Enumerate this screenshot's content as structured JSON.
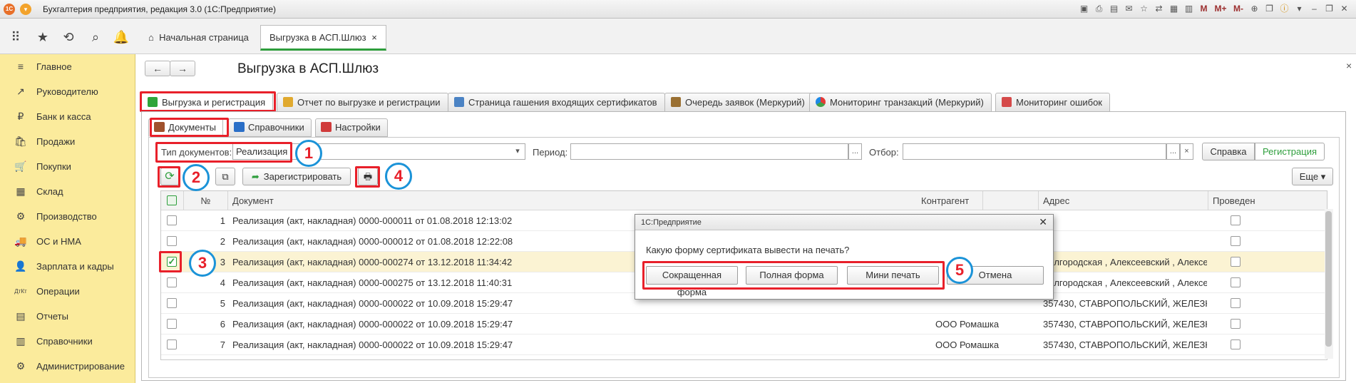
{
  "window": {
    "title": "Бухгалтерия предприятия, редакция 3.0  (1С:Предприятие)",
    "logo": "1С"
  },
  "titlebar_icons": [
    "save-icon",
    "print-icon",
    "preview-icon",
    "mail-icon",
    "star-icon",
    "nav-icon",
    "calendar-icon",
    "calc-icon",
    "M",
    "M+",
    "M-",
    "zoom-icon",
    "window-icon",
    "info-icon",
    "chevron-down-icon",
    "minimize-icon",
    "restore-icon",
    "close-icon"
  ],
  "topnav": {
    "tabs": [
      {
        "label": "Начальная страница"
      },
      {
        "label": "Выгрузка в АСП.Шлюз",
        "close": "×"
      }
    ]
  },
  "sidebar": {
    "items": [
      {
        "label": "Главное",
        "icon": "≡"
      },
      {
        "label": "Руководителю",
        "icon": "↗"
      },
      {
        "label": "Банк и касса",
        "icon": "₽"
      },
      {
        "label": "Продажи",
        "icon": "🛍"
      },
      {
        "label": "Покупки",
        "icon": "🛒"
      },
      {
        "label": "Склад",
        "icon": "▦"
      },
      {
        "label": "Производство",
        "icon": "⚙"
      },
      {
        "label": "ОС и НМА",
        "icon": "🚚"
      },
      {
        "label": "Зарплата и кадры",
        "icon": "👤"
      },
      {
        "label": "Операции",
        "icon": "ДтКт"
      },
      {
        "label": "Отчеты",
        "icon": "▤"
      },
      {
        "label": "Справочники",
        "icon": "▥"
      },
      {
        "label": "Администрирование",
        "icon": "⚙"
      }
    ]
  },
  "page": {
    "title": "Выгрузка в АСП.Шлюз",
    "back": "←",
    "forward": "→",
    "close": "×"
  },
  "form_tabs": [
    "Выгрузка и регистрация",
    "Отчет по выгрузке и регистрации",
    "Страница гашения входящих сертификатов",
    "Очередь заявок (Меркурий)",
    "Мониторинг транзакций (Меркурий)",
    "Мониторинг ошибок"
  ],
  "sub_tabs": [
    "Документы",
    "Справочники",
    "Настройки"
  ],
  "filters": {
    "doc_type_label": "Тип документов:",
    "doc_type_value": "Реализация",
    "period_label": "Период:",
    "period_value": "",
    "filter_label": "Отбор:",
    "filter_value": "",
    "ellipsis": "...",
    "dropdown": "▾",
    "clear": "×",
    "mode_buttons": [
      "Справка",
      "Регистрация"
    ]
  },
  "toolbar": {
    "refresh": "⟳",
    "copy": "⧉",
    "register_label": "Зарегистрировать",
    "print": "🖶",
    "more_label": "Еще",
    "more_caret": "▾"
  },
  "markers": [
    "1",
    "2",
    "3",
    "4",
    "5"
  ],
  "table": {
    "columns": [
      "№",
      "Документ",
      "Контрагент",
      "Адрес",
      "Проведен"
    ],
    "rows": [
      {
        "n": "1",
        "doc": "Реализация (акт, накладная) 0000-000011 от 01.08.2018 12:13:02",
        "counterparty": "",
        "address": "",
        "checked": false
      },
      {
        "n": "2",
        "doc": "Реализация (акт, накладная) 0000-000012 от 01.08.2018 12:22:08",
        "counterparty": "",
        "address": "",
        "checked": false
      },
      {
        "n": "3",
        "doc": "Реализация (акт, накладная) 0000-000274 от 13.12.2018 11:34:42",
        "counterparty": "",
        "address": "Белгородская , Алексеевский , Алексеевк...",
        "checked": true
      },
      {
        "n": "4",
        "doc": "Реализация (акт, накладная) 0000-000275 от 13.12.2018 11:40:31",
        "counterparty": "",
        "address": "Белгородская , Алексеевский , Алексеевк...",
        "checked": false
      },
      {
        "n": "5",
        "doc": "Реализация (акт, накладная) 0000-000022 от 10.09.2018 15:29:47",
        "counterparty": "",
        "address": "357430, СТАВРОПОЛЬСКИЙ, ЖЕЛЕЗНОВ...",
        "checked": false
      },
      {
        "n": "6",
        "doc": "Реализация (акт, накладная) 0000-000022 от 10.09.2018 15:29:47",
        "counterparty": "ООО Ромашка",
        "address": "357430, СТАВРОПОЛЬСКИЙ, ЖЕЛЕЗНОВ...",
        "checked": false
      },
      {
        "n": "7",
        "doc": "Реализация (акт, накладная) 0000-000022 от 10.09.2018 15:29:47",
        "counterparty": "ООО Ромашка",
        "address": "357430, СТАВРОПОЛЬСКИЙ, ЖЕЛЕЗНОВ...",
        "checked": false
      }
    ]
  },
  "dialog": {
    "title": "1С:Предприятие",
    "close": "✕",
    "question": "Какую форму сертификата вывести на печать?",
    "buttons": [
      "Сокращенная форма",
      "Полная форма",
      "Мини печать",
      "Отмена"
    ]
  }
}
